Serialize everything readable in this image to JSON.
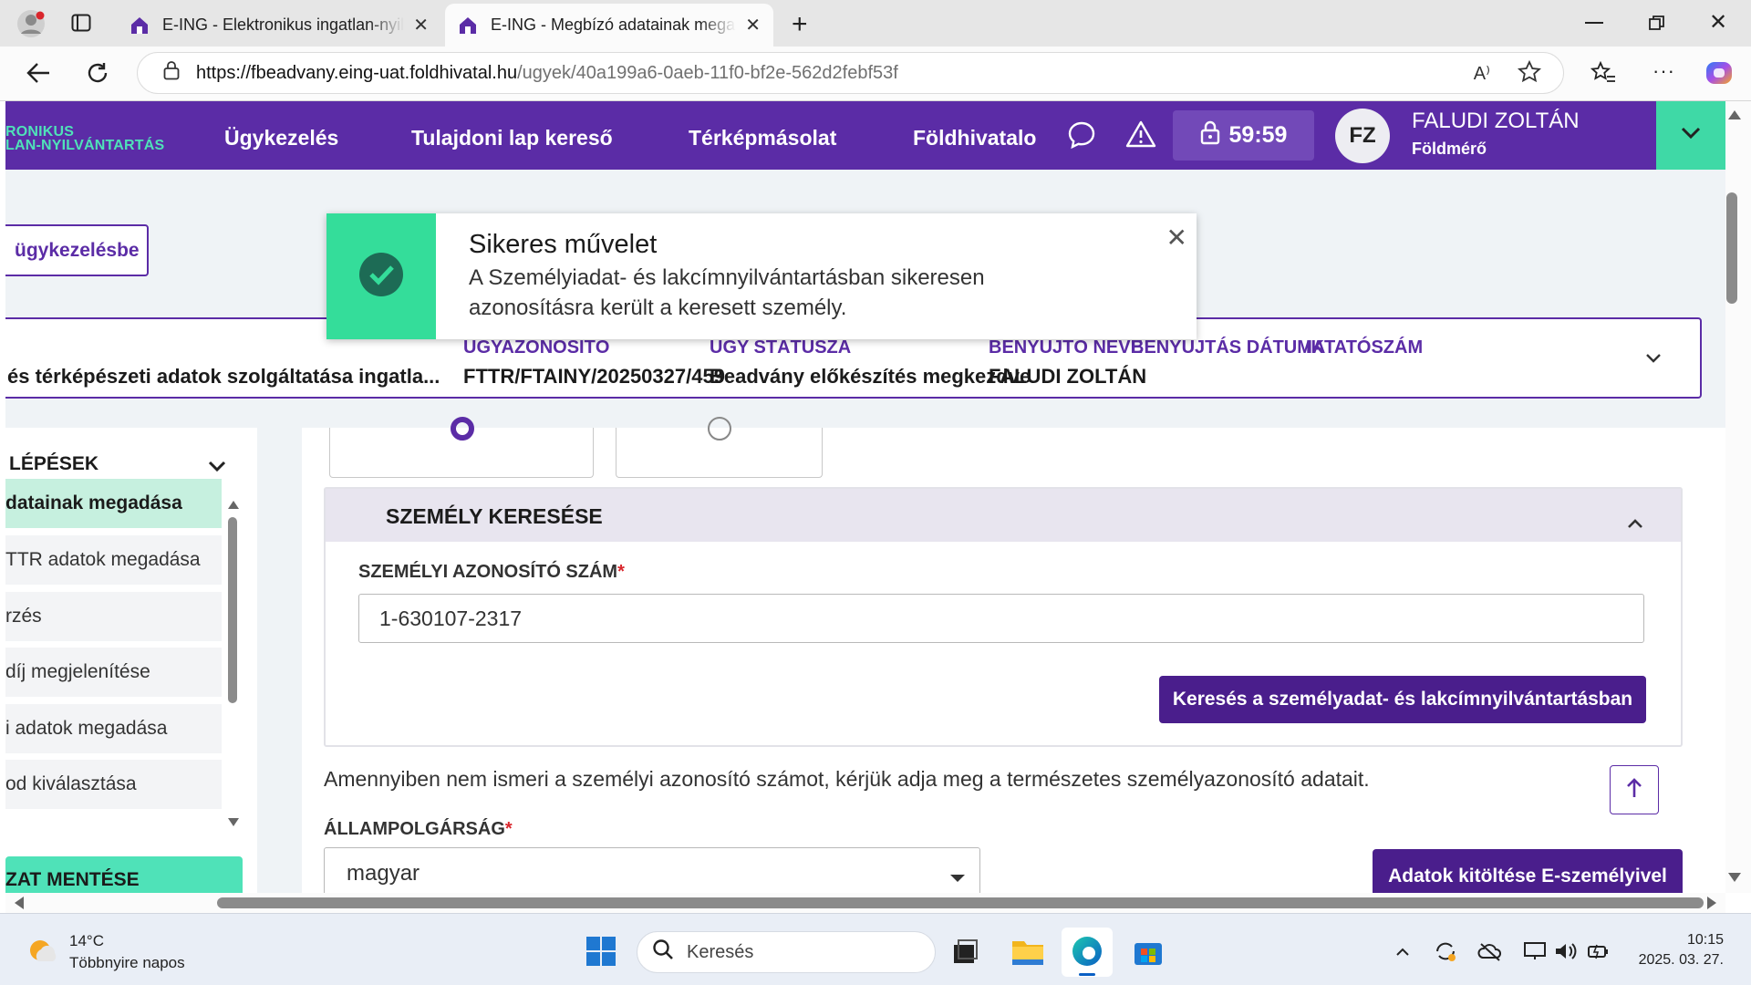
{
  "browser": {
    "tabs": [
      {
        "title": "E-ING - Elektronikus ingatlan-nyilvántartás",
        "active": false
      },
      {
        "title": "E-ING - Megbízó adatainak megadása",
        "active": true
      }
    ],
    "url_host": "https://fbeadvany.eing-uat.foldhivatal.hu",
    "url_path": "/ugyek/40a199a6-0aeb-11f0-bf2e-562d2febf53f",
    "read_aloud_label": "A⁾"
  },
  "header": {
    "logo_line1": "RONIKUS",
    "logo_line2": "LAN-NYILVÁNTARTÁS",
    "nav": [
      "Ügykezelés",
      "Tulajdoni lap kereső",
      "Térképmásolat",
      "Földhivatalo"
    ],
    "timer": "59:59",
    "avatar_initials": "FZ",
    "user_name": "FALUDI ZOLTÁN",
    "user_role": "Földmérő",
    "brand_color": "#5b2ca6",
    "accent_color": "#3fd9a6"
  },
  "page": {
    "back_button": "ügykezelésbe",
    "info": {
      "service": "és térképészeti adatok szolgáltatása ingatla...",
      "case_id_label": "ÜGYAZONOSÍTÓ",
      "case_id": "FTTR/FTAINY/20250327/459",
      "status_label": "ÜGY STÁTUSZA",
      "status": "Beadvány előkészítés megkezdve",
      "submitter_label": "BENYÚJTÓ NEVE",
      "submitter": "FALUDI ZOLTÁN",
      "date_label": "BENYÚJTÁS DÁTUMA",
      "filing_label": "IKTATÓSZÁM"
    },
    "steps": {
      "title": "LÉPÉSEK",
      "items": [
        "datainak megadása",
        "TTR adatok megadása",
        "rzés",
        "díj megjelenítése",
        "i adatok megadása",
        "od kiválasztása"
      ],
      "save_button": "ZAT MENTÉSE"
    },
    "person_search": {
      "title": "SZEMÉLY KERESÉSE",
      "id_label": "SZEMÉLYI AZONOSÍTÓ SZÁM",
      "required_mark": "*",
      "id_value": "1-630107-2317",
      "search_button": "Keresés a személyadat- és lakcímnyilvántartásban"
    },
    "help_text": "Amennyiben nem ismeri a személyi azonosító számot, kérjük adja meg a természetes személyazonosító adatait.",
    "citizenship_label": "ÁLLAMPOLGÁRSÁG",
    "citizenship_value": "magyar",
    "eid_button": "Adatok kitöltése E-személyivel"
  },
  "toast": {
    "title": "Sikeres művelet",
    "message": "A Személyiadat- és lakcímnyilvántartásban sikeresen azonosításra került a keresett személy.",
    "color": "#34dd9a"
  },
  "taskbar": {
    "temperature": "14°C",
    "weather": "Többnyire napos",
    "search_placeholder": "Keresés",
    "time": "10:15",
    "date": "2025. 03. 27."
  }
}
